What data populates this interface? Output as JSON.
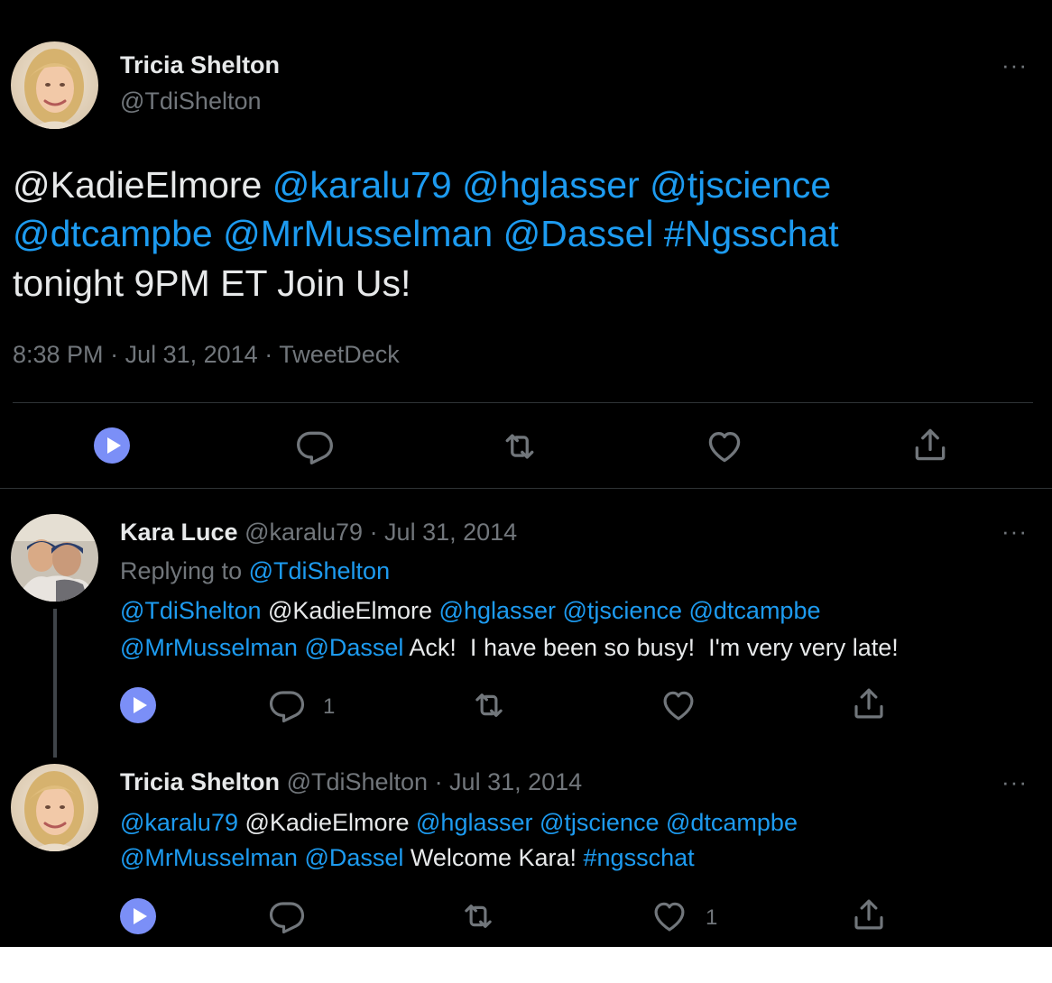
{
  "colors": {
    "background": "#000000",
    "text": "#e7e9ea",
    "muted": "#71767b",
    "link": "#1d9bf0",
    "play_button": "#7b8ff7"
  },
  "main_tweet": {
    "author_name": "Tricia Shelton",
    "author_handle": "@TdiShelton",
    "more_label": "···",
    "line1": {
      "mention1": "@KadieElmore",
      "mention2": "@karalu79",
      "mention3": "@hglasser",
      "mention4": "@tjscience"
    },
    "line2": {
      "mention1": "@dtcampbe",
      "mention2": "@MrMusselman",
      "mention3": "@Dassel",
      "hashtag": "#Ngsschat"
    },
    "line3": "tonight 9PM ET Join Us!",
    "meta": {
      "time": "8:38 PM",
      "sep1": " · ",
      "date": "Jul 31, 2014",
      "sep2": " · ",
      "source": "TweetDeck"
    },
    "actions": [
      "play-icon",
      "reply-icon",
      "retweet-icon",
      "like-icon",
      "share-icon"
    ]
  },
  "reply1": {
    "author_name": "Kara Luce",
    "author_handle": "@karalu79",
    "date": " · Jul 31, 2014",
    "more_label": "···",
    "replying_prefix": "Replying to ",
    "replying_handle": "@TdiShelton",
    "line1": {
      "mention1": "@TdiShelton",
      "mention2": "@KadieElmore",
      "mention3": "@hglasser",
      "mention4": "@tjscience",
      "mention5": "@dtcampbe"
    },
    "line2": {
      "mention1": "@MrMusselman",
      "mention2": "@Dassel",
      "text": "Ack!  I have been so busy!  I'm very very late!"
    },
    "reply_count": "1",
    "actions": [
      "play-icon",
      "reply-icon",
      "retweet-icon",
      "like-icon",
      "share-icon"
    ]
  },
  "reply2": {
    "author_name": "Tricia Shelton",
    "author_handle": "@TdiShelton",
    "date": " · Jul 31, 2014",
    "more_label": "···",
    "line1": {
      "mention1": "@karalu79",
      "mention2": "@KadieElmore",
      "mention3": "@hglasser",
      "mention4": "@tjscience",
      "mention5": "@dtcampbe"
    },
    "line2": {
      "mention1": "@MrMusselman",
      "mention2": "@Dassel",
      "text": "Welcome Kara!",
      "hashtag": "#ngsschat"
    },
    "like_count": "1",
    "actions": [
      "play-icon",
      "reply-icon",
      "retweet-icon",
      "like-icon",
      "share-icon"
    ]
  }
}
